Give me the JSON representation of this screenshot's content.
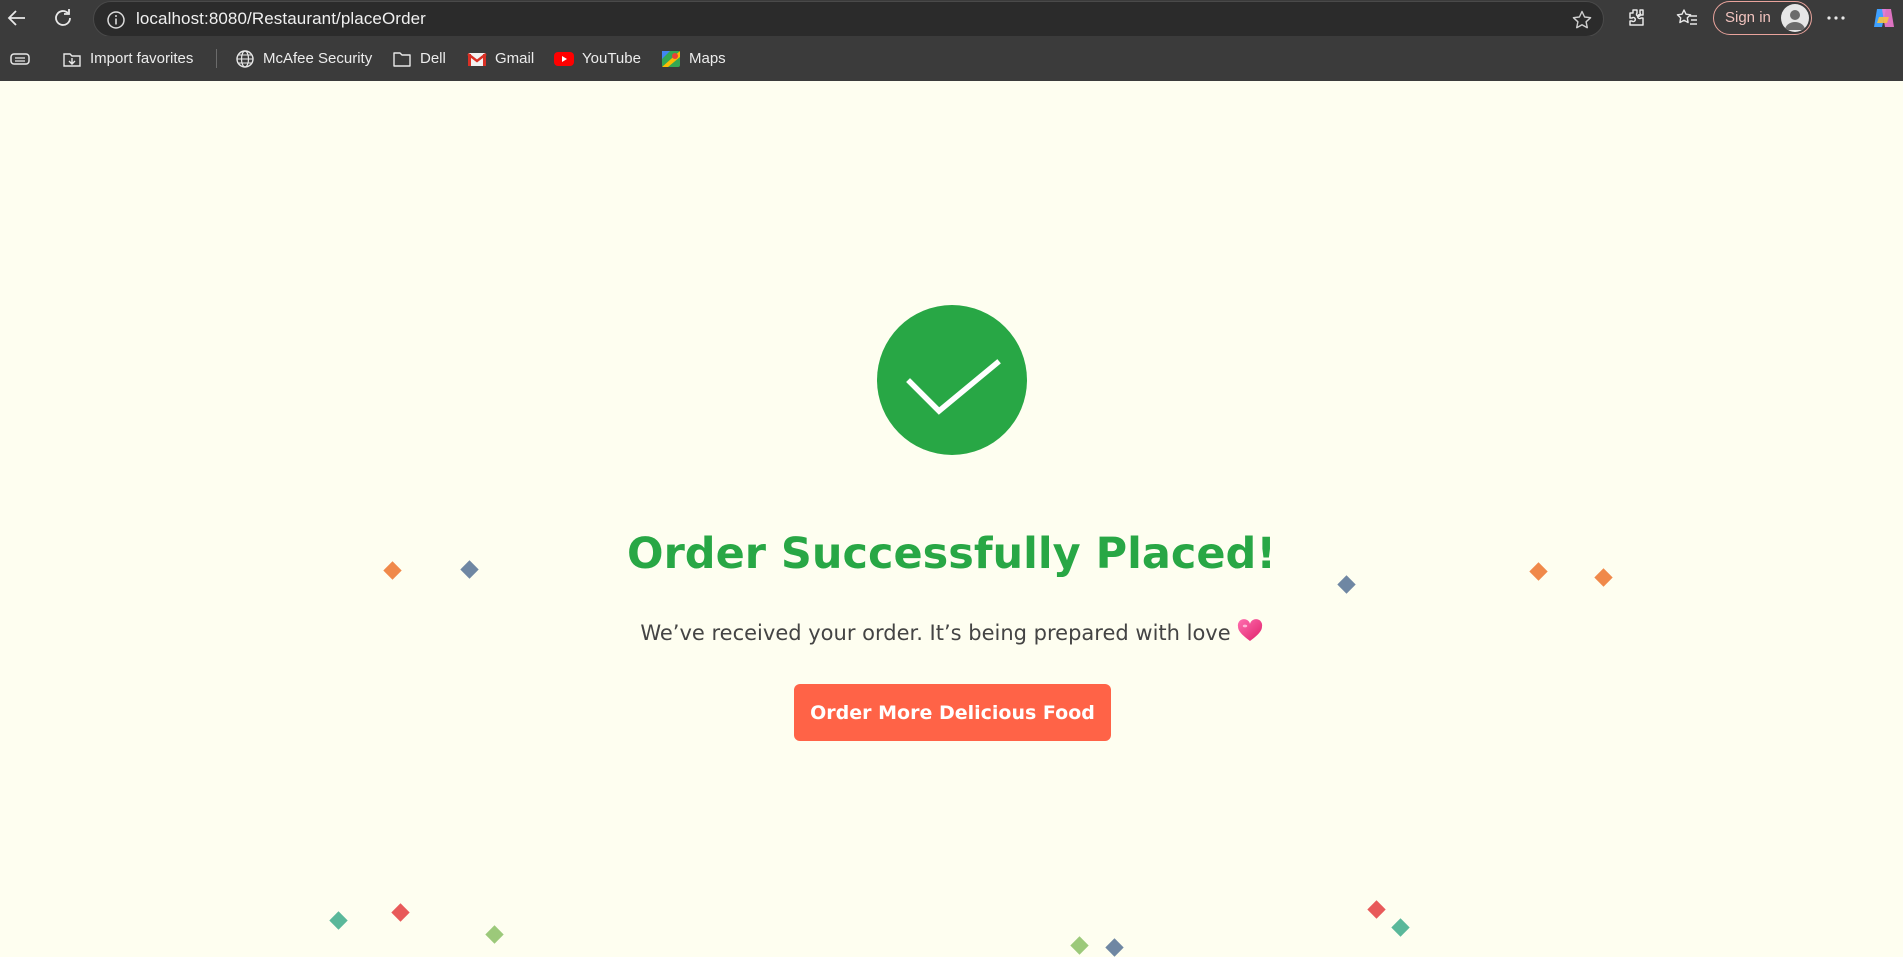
{
  "browser": {
    "url": "localhost:8080/Restaurant/placeOrder",
    "sign_in_label": "Sign in",
    "nav_icons": [
      "back-icon",
      "refresh-icon"
    ],
    "toolbar_icons": [
      "extensions-icon",
      "favorites-icon",
      "more-icon",
      "copilot-icon"
    ]
  },
  "bookmarks": [
    {
      "label": "Import favorites",
      "icon": "import-icon"
    },
    {
      "label": "McAfee Security",
      "icon": "globe-icon"
    },
    {
      "label": "Dell",
      "icon": "folder-icon"
    },
    {
      "label": "Gmail",
      "icon": "gmail-icon"
    },
    {
      "label": "YouTube",
      "icon": "youtube-icon"
    },
    {
      "label": "Maps",
      "icon": "maps-icon"
    }
  ],
  "main": {
    "title": "Order Successfully Placed!",
    "message": "We’ve received your order. It’s being prepared with love",
    "message_emoji": "heart-icon",
    "button_label": "Order More Delicious Food"
  },
  "colors": {
    "success": "#28a745",
    "button": "#ff6347",
    "background": "#fefef0",
    "chrome": "#3b3b3b"
  },
  "confetti_colors": [
    "#f0894a",
    "#6f87a3",
    "#e85a5a",
    "#5ab89a",
    "#9cc97a"
  ]
}
